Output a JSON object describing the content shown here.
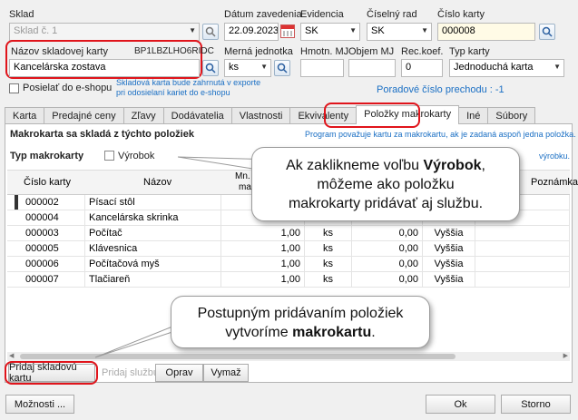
{
  "header": {
    "sklad_label": "Sklad",
    "sklad_value": "Sklad č. 1",
    "datum_label": "Dátum zavedenia",
    "datum_value": "22.09.2023",
    "evidencia_label": "Evidencia",
    "evidencia_value": "SK",
    "ciselny_rad_label": "Číselný rad",
    "ciselny_rad_value": "SK",
    "cislo_karty_label": "Číslo karty",
    "cislo_karty_value": "000008",
    "nazov_label": "Názov skladovej karty",
    "nazov_code": "BP1LBZLHO6RIDC",
    "nazov_value": "Kancelárska zostava",
    "mj_label": "Merná jednotka",
    "mj_value": "ks",
    "hmotn_label": "Hmotn. MJ",
    "objem_label": "Objem MJ",
    "rec_label": "Rec.koef.",
    "rec_value": "0",
    "typ_label": "Typ karty",
    "typ_value": "Jednoduchá karta",
    "eshop_label": "Posielať do e-shopu",
    "eshop_note_1": "Skladová karta bude zahrnutá v exporte",
    "eshop_note_2": "pri odosielaní kariet do e-shopu",
    "poradove": "Poradové číslo prechodu : -1"
  },
  "tabs": [
    "Karta",
    "Predajné ceny",
    "Zľavy",
    "Dodávatelia",
    "Vlastnosti",
    "Ekvivalenty",
    "Položky makrokarty",
    "Iné",
    "Súbory"
  ],
  "panel": {
    "title": "Makrokarta sa skladá z týchto položiek",
    "info": "Program považuje kartu za makrokartu, ak je zadaná aspoň jedna položka.",
    "typ_label": "Typ makrokarty",
    "vyrobok_label": "Výrobok",
    "vyrobok_note": "výrobku.",
    "columns": [
      "Číslo karty",
      "Názov",
      "Mn.",
      "",
      "",
      "",
      "",
      "Poznámka"
    ],
    "col_mn_sub": "ma",
    "rows": [
      {
        "cislo": "000002",
        "nazov": "Písací stôl",
        "mn": "",
        "mj": "",
        "cena": "",
        "sadzba": ""
      },
      {
        "cislo": "000004",
        "nazov": "Kancelárska skrinka",
        "mn": "",
        "mj": "",
        "cena": "",
        "sadzba": ""
      },
      {
        "cislo": "000003",
        "nazov": "Počítač",
        "mn": "1,00",
        "mj": "ks",
        "cena": "0,00",
        "sadzba": "Vyššia"
      },
      {
        "cislo": "000005",
        "nazov": "Klávesnica",
        "mn": "1,00",
        "mj": "ks",
        "cena": "0,00",
        "sadzba": "Vyššia"
      },
      {
        "cislo": "000006",
        "nazov": "Počítačová myš",
        "mn": "1,00",
        "mj": "ks",
        "cena": "0,00",
        "sadzba": "Vyššia"
      },
      {
        "cislo": "000007",
        "nazov": "Tlačiareň",
        "mn": "1,00",
        "mj": "ks",
        "cena": "0,00",
        "sadzba": "Vyššia"
      }
    ]
  },
  "buttons": {
    "pridaj_kartu": "Pridaj skladovú kartu",
    "pridaj_sluzbu": "Pridaj službu",
    "oprav": "Oprav",
    "vymaz": "Vymaž",
    "moznosti": "Možnosti ...",
    "ok": "Ok",
    "storno": "Storno"
  },
  "callouts": {
    "c1_a": "Ak zaklikneme voľbu ",
    "c1_b": "Výrobok",
    ",": ",",
    "c1_c": "môžeme ako položku",
    "c1_d": "makrokarty pridávať aj službu.",
    "c2_a": "Postupným pridávaním položiek",
    "c2_b": "vytvoríme ",
    "c2_c": "makrokartu",
    "c2_d": "."
  },
  "colors": {
    "accent_red": "#e0141b",
    "link_blue": "#1a6fc4"
  }
}
